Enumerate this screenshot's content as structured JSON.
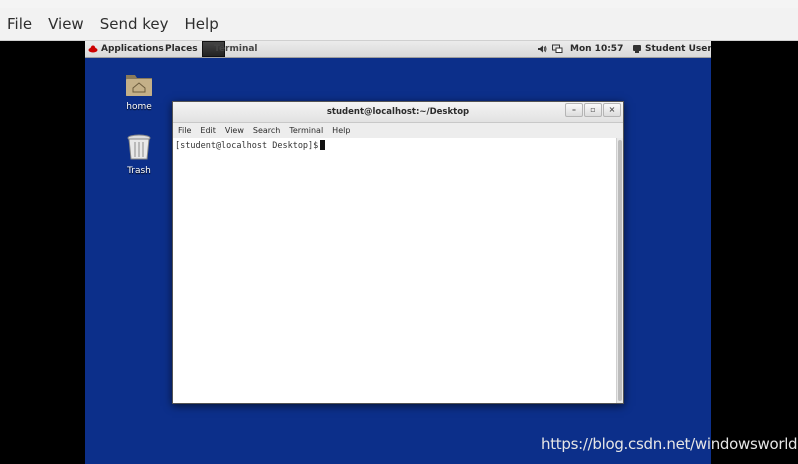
{
  "viewer": {
    "menu": [
      "File",
      "View",
      "Send key",
      "Help"
    ]
  },
  "panel": {
    "applications": "Applications",
    "places": "Places",
    "taskbar_item": "Terminal",
    "clock": "Mon 10:57",
    "user": "Student User"
  },
  "desktop": {
    "home_label": "home",
    "trash_label": "Trash"
  },
  "terminal": {
    "title": "student@localhost:~/Desktop",
    "menu": [
      "File",
      "Edit",
      "View",
      "Search",
      "Terminal",
      "Help"
    ],
    "prompt": "[student@localhost Desktop]$",
    "window_buttons": [
      "minimize",
      "maximize",
      "close"
    ]
  },
  "watermark": "https://blog.csdn.net/windowsworld",
  "colors": {
    "desktop_background": "#0c2f8a",
    "viewer_menubar": "#f2f2f2"
  }
}
